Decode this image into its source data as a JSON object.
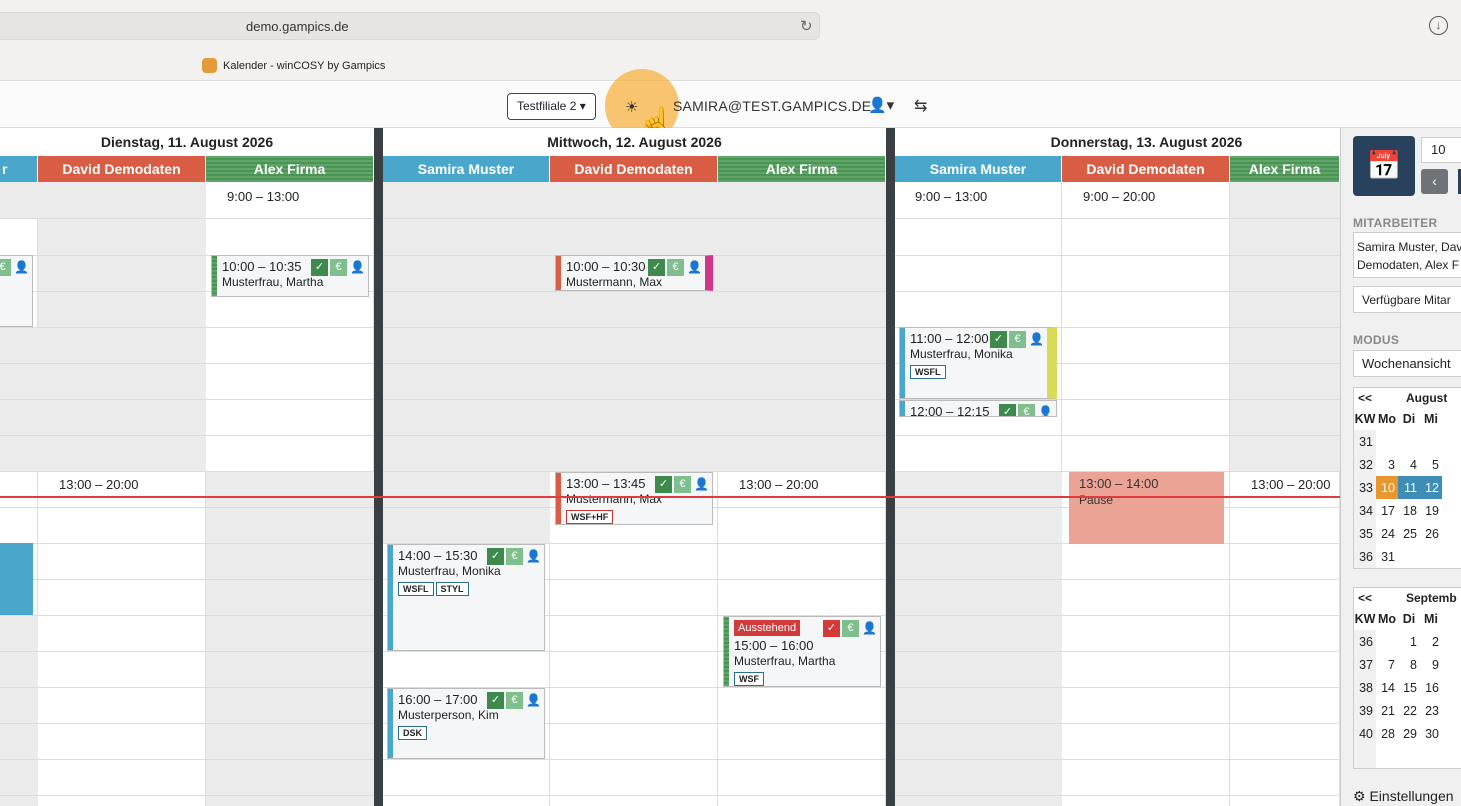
{
  "browser": {
    "url": "demo.gampics.de",
    "tab_title": "Kalender - winCOSY by Gampics"
  },
  "topbar": {
    "branch": "Testfiliale 2",
    "user": "SAMIRA@TEST.GAMPICS.DE"
  },
  "days": [
    {
      "label": "Dienstag, 11. August 2026"
    },
    {
      "label": "Mittwoch, 12. August 2026"
    },
    {
      "label": "Donnerstag, 13. August 2026"
    }
  ],
  "employees": {
    "samira": "Samira Muster",
    "david": "David Demodaten",
    "alex": "Alex Firma",
    "samira_partial": "r"
  },
  "worktimes": {
    "tue_alex": "9:00 – 13:00",
    "tue_david_pm": "13:00 – 20:00",
    "wed_alex_pm": "13:00 – 20:00",
    "thu_samira": "9:00 – 13:00",
    "thu_david": "9:00 – 20:00",
    "thu_alex_pm": "13:00 – 20:00"
  },
  "appointments": {
    "a1": {
      "time": "10:00 – 10:35",
      "name": "Musterfrau, Martha"
    },
    "a2": {
      "time": "10:00 – 10:30",
      "name": "Mustermann, Max"
    },
    "a3": {
      "time": "13:00 – 13:45",
      "name": "Mustermann, Max",
      "tag": "WSF+HF"
    },
    "a4": {
      "time": "14:00 – 15:30",
      "name": "Musterfrau, Monika",
      "tags": [
        "WSFL",
        "STYL"
      ]
    },
    "a5": {
      "time": "16:00 – 17:00",
      "name": "Musterperson, Kim",
      "tag": "DSK"
    },
    "a6": {
      "status": "Ausstehend",
      "time": "15:00 – 16:00",
      "name": "Musterfrau, Martha",
      "tag": "WSF"
    },
    "a7": {
      "time": "11:00 – 12:00",
      "name": "Musterfrau, Monika",
      "tag": "WSFL"
    },
    "a8": {
      "time": "12:00 – 12:15"
    },
    "pause": {
      "time": "13:00 – 14:00",
      "name": "Pause"
    }
  },
  "icons": {
    "euro": "€",
    "check": "✓",
    "person": "person-check-icon"
  },
  "sidebar": {
    "number": "10",
    "mitarbeiter_label": "MITARBEITER",
    "mitarbeiter_value_1": "Samira Muster, Dav",
    "mitarbeiter_value_2": "Demodaten, Alex F",
    "verfuegbar": "Verfügbare Mitar",
    "modus_label": "MODUS",
    "modus_value": "Wochenansicht",
    "settings": "Einstellungen"
  },
  "minical_aug": {
    "nav": "<<",
    "month": "August",
    "headers": [
      "KW",
      "Mo",
      "Di",
      "Mi"
    ],
    "rows": [
      [
        "31",
        "",
        "",
        ""
      ],
      [
        "32",
        "3",
        "4",
        "5"
      ],
      [
        "33",
        "10",
        "11",
        "12"
      ],
      [
        "34",
        "17",
        "18",
        "19"
      ],
      [
        "35",
        "24",
        "25",
        "26"
      ],
      [
        "36",
        "31",
        "",
        ""
      ]
    ]
  },
  "minical_sep": {
    "nav": "<<",
    "month": "Septemb",
    "headers": [
      "KW",
      "Mo",
      "Di",
      "Mi"
    ],
    "rows": [
      [
        "36",
        "",
        "1",
        "2"
      ],
      [
        "37",
        "7",
        "8",
        "9"
      ],
      [
        "38",
        "14",
        "15",
        "16"
      ],
      [
        "39",
        "21",
        "22",
        "23"
      ],
      [
        "40",
        "28",
        "29",
        "30"
      ]
    ]
  },
  "colors": {
    "samira": "#48a7cb",
    "david": "#d95c44",
    "alex": "#4b9455",
    "accent": "#28425e",
    "today": "#e8962f"
  }
}
